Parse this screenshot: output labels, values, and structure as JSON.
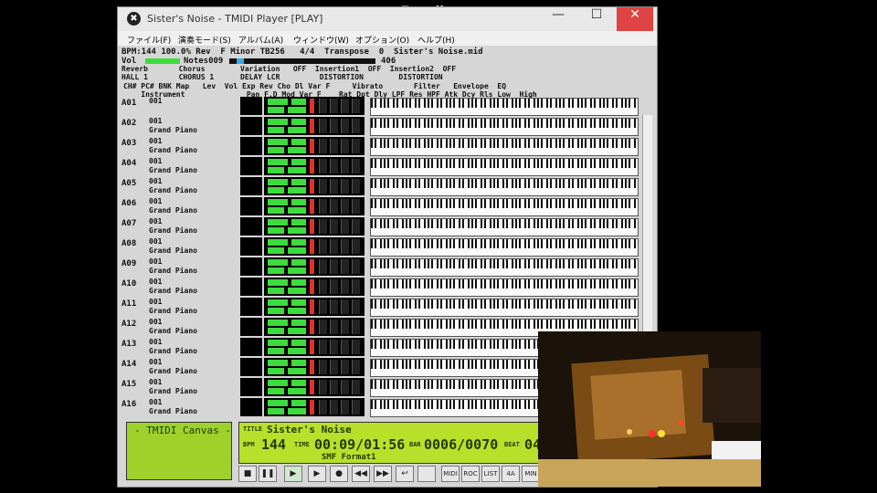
{
  "watermark": "www.Bandicam.com",
  "window": {
    "title": "Sister's Noise - TMIDI Player [PLAY]",
    "buttons": [
      "—",
      "☐",
      "✕"
    ]
  },
  "menu": [
    "ファイル(F)",
    "演奏モード(S)",
    "アルバム(A)",
    "ウィンドウ(W)",
    "オプション(O)",
    "ヘルプ(H)"
  ],
  "status": {
    "line1": "BPM:144 100.0% Rev  F Minor TB256   4/4  Transpose  0  Sister's Noise.mid",
    "line2_vol": "Vol",
    "line2_notes": "Notes009",
    "line2_val": "406",
    "effects": "Reverb       Chorus        Variation   OFF  Insertion1  OFF  Insertion2  OFF",
    "effects2": "HALL 1       CHORUS 1      DELAY LCR         DISTORTION        DISTORTION"
  },
  "columns": {
    "row1": "CH# PC# BNK Map   Lev  Vol Exp Rev Cho Dl Var F     Vibrato       Filter   Envelope  EQ",
    "row2": "    Instrument              Pan F.D Mod Var F    Rat Dpt Dly LPF Res HPF Atk Dcy Rls Low  High"
  },
  "channels": [
    {
      "ch": "A01",
      "pc": "001",
      "name": ""
    },
    {
      "ch": "A02",
      "pc": "001",
      "name": "Grand Piano"
    },
    {
      "ch": "A03",
      "pc": "001",
      "name": "Grand Piano"
    },
    {
      "ch": "A04",
      "pc": "001",
      "name": "Grand Piano"
    },
    {
      "ch": "A05",
      "pc": "001",
      "name": "Grand Piano"
    },
    {
      "ch": "A06",
      "pc": "001",
      "name": "Grand Piano"
    },
    {
      "ch": "A07",
      "pc": "001",
      "name": "Grand Piano"
    },
    {
      "ch": "A08",
      "pc": "001",
      "name": "Grand Piano"
    },
    {
      "ch": "A09",
      "pc": "001",
      "name": "Grand Piano"
    },
    {
      "ch": "A10",
      "pc": "001",
      "name": "Grand Piano"
    },
    {
      "ch": "A11",
      "pc": "001",
      "name": "Grand Piano"
    },
    {
      "ch": "A12",
      "pc": "001",
      "name": "Grand Piano"
    },
    {
      "ch": "A13",
      "pc": "001",
      "name": "Grand Piano"
    },
    {
      "ch": "A14",
      "pc": "001",
      "name": "Grand Piano"
    },
    {
      "ch": "A15",
      "pc": "001",
      "name": "Grand Piano"
    },
    {
      "ch": "A16",
      "pc": "001",
      "name": "Grand Piano"
    }
  ],
  "canvas": {
    "title": "- TMIDI Canvas -"
  },
  "lcd": {
    "title_label": "TITLE",
    "title": "Sister's Noise",
    "bpm_label": "BPM",
    "bpm": "144",
    "time_label": "TIME",
    "time": "00:09/01:56",
    "bar_label": "BAR",
    "bar": "0006/0070",
    "beat_label": "BEAT",
    "beat": "04",
    "format": "SMF Format1"
  },
  "controls": [
    "■",
    "❚❚",
    "▶",
    "▶",
    "●",
    "◀◀",
    "▶▶",
    "↩",
    "",
    "MIDI",
    "ROC",
    "LIST",
    "4A",
    "MIN"
  ],
  "colors": {
    "led_green": "#3ddc3d",
    "lcd": "#b8e02a",
    "close": "#e04343"
  }
}
